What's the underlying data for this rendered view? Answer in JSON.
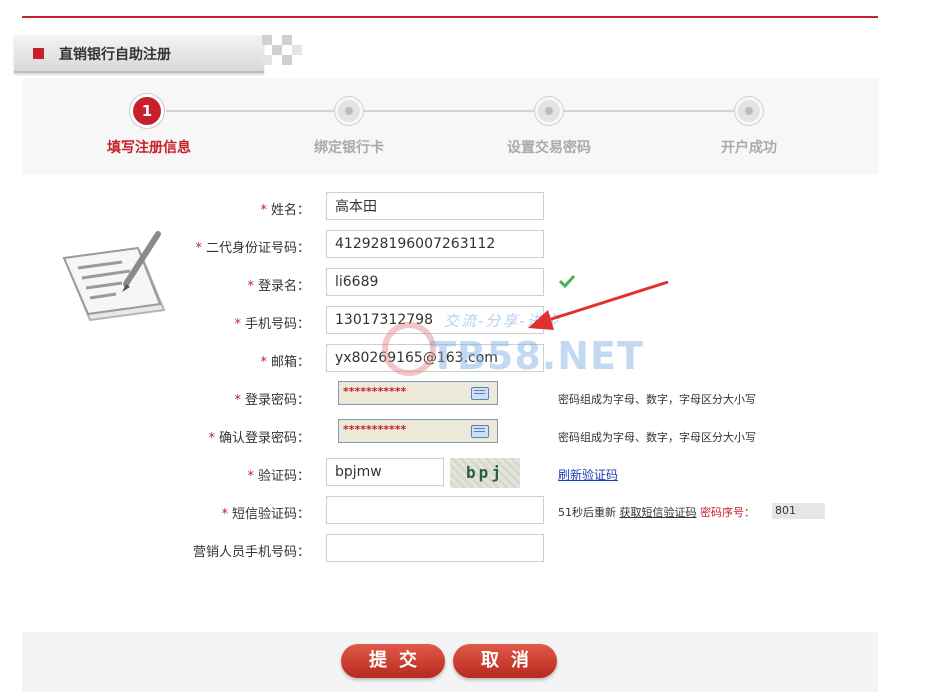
{
  "header": {
    "title": "直销银行自助注册"
  },
  "steps": [
    {
      "number": "1",
      "label": "填写注册信息",
      "active": true
    },
    {
      "label": "绑定银行卡",
      "active": false
    },
    {
      "label": "设置交易密码",
      "active": false
    },
    {
      "label": "开户成功",
      "active": false
    }
  ],
  "form": {
    "name": {
      "label": "姓名：",
      "value": "高本田"
    },
    "id_card": {
      "label": "二代身份证号码：",
      "value": "412928196007263112"
    },
    "login_name": {
      "label": "登录名：",
      "value": "li6689"
    },
    "phone": {
      "label": "手机号码：",
      "value": "13017312798"
    },
    "email": {
      "label": "邮箱：",
      "value": "yx80269165@163.com"
    },
    "password": {
      "label": "登录密码：",
      "mask": "***********",
      "hint": "密码组成为字母、数字，字母区分大小写"
    },
    "confirm_password": {
      "label": "确认登录密码：",
      "mask": "***********",
      "hint": "密码组成为字母、数字，字母区分大小写"
    },
    "captcha": {
      "label": "验证码：",
      "value": "bpjmw",
      "image_text": "bpj mw",
      "refresh_label": "刷新验证码"
    },
    "sms_code": {
      "label": "短信验证码：",
      "value": "",
      "countdown": "51秒后重新",
      "get_link": "获取短信验证码",
      "seq_label": "密码序号：",
      "seq_value": "801"
    },
    "marketer_phone": {
      "label": "营销人员手机号码：",
      "value": ""
    }
  },
  "required_mark": "*",
  "buttons": {
    "submit": "提交",
    "cancel": "取消"
  },
  "watermark": {
    "text": "TB58.NET",
    "sub": "交流-分享-进步"
  },
  "colors": {
    "accent": "#c8202a",
    "valid": "#4caf50",
    "link": "#1a3fb5"
  },
  "icons": {
    "valid": "check-icon",
    "document": "document-pen-icon",
    "keyboard": "keyboard-icon"
  }
}
